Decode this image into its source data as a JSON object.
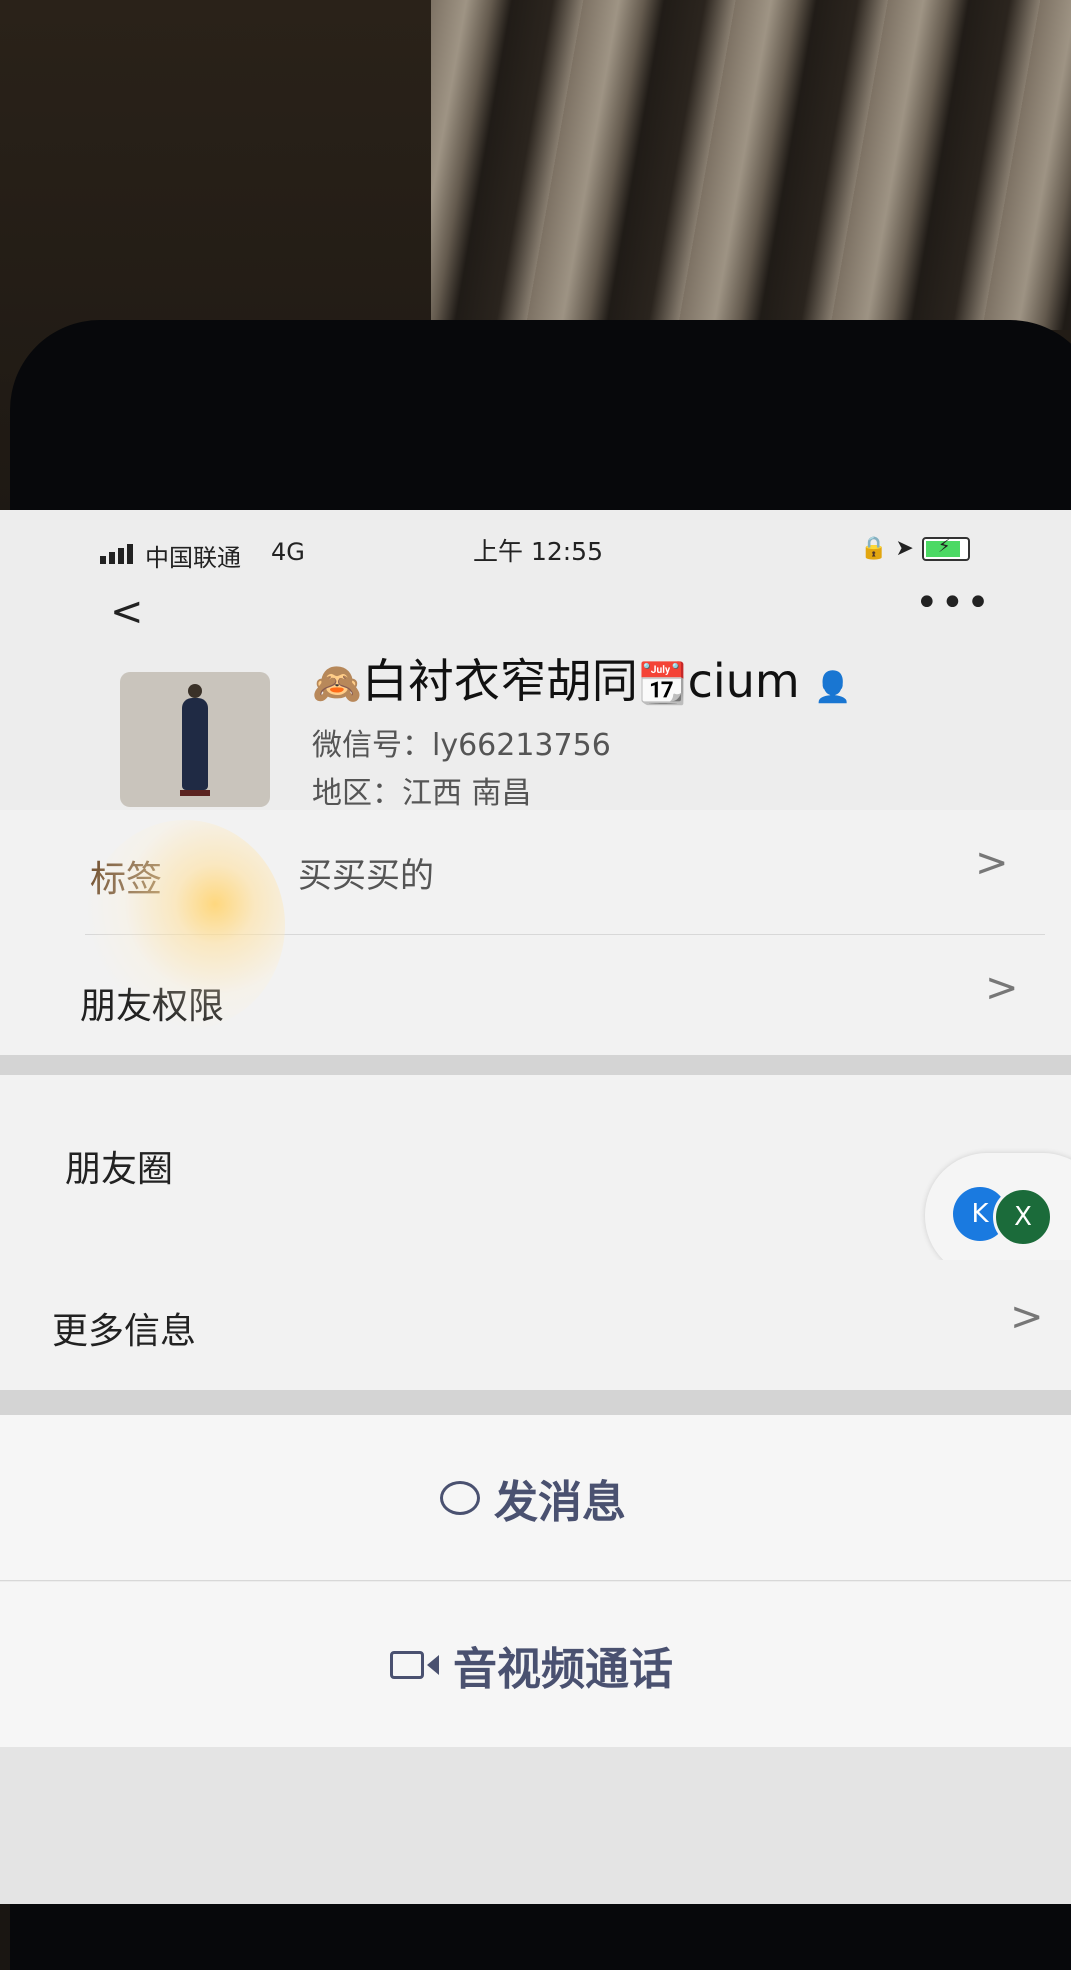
{
  "status_bar": {
    "carrier": "中国联通",
    "network": "4G",
    "time": "上午 12:55",
    "battery_bolt": "⚡"
  },
  "nav": {
    "back_glyph": "<",
    "more_glyph": "•••"
  },
  "profile": {
    "emoji_prefix": "🙈",
    "name_text": "白衬衣窄胡同",
    "emoji_mid": "📆",
    "name_suffix": "cium",
    "emoji_suffix": "👤",
    "wechat_id": "微信号：ly66213756",
    "region": "地区：江西 南昌"
  },
  "rows": {
    "tags_label": "标签",
    "tags_value": "买买买的",
    "permissions_label": "朋友权限",
    "moments_label": "朋友圈",
    "more_info_label": "更多信息",
    "chevron": ">"
  },
  "floating": {
    "icon_a": "K",
    "icon_b": "X"
  },
  "actions": {
    "message_label": "发消息",
    "call_label": "音视频通话"
  },
  "colors": {
    "accent": "#4a5170",
    "screen_bg": "#ededed",
    "moments_icon_blue": "#1a7ae0",
    "moments_icon_green": "#1b6b3a"
  }
}
